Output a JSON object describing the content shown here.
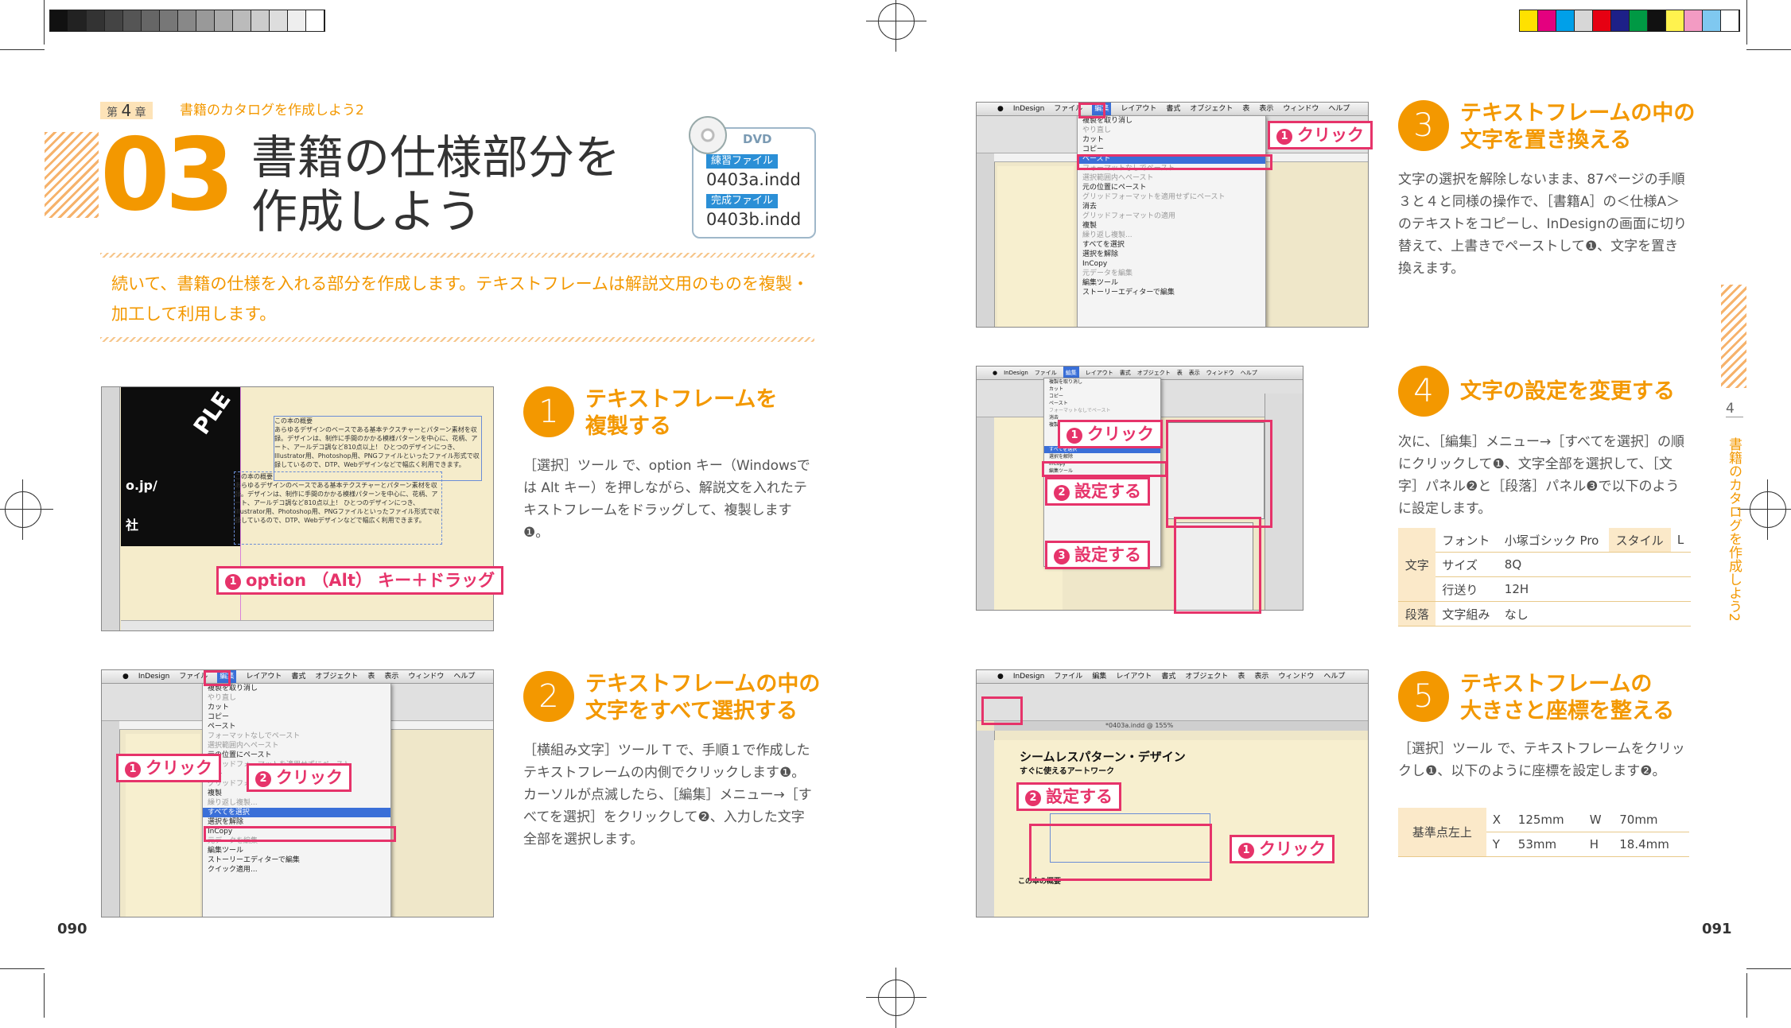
{
  "chapter": {
    "label_prefix": "第",
    "number": "4",
    "label_suffix": "章",
    "title": "書籍のカタログを作成しよう2"
  },
  "section": {
    "number": "03",
    "title_line1": "書籍の仕様部分を",
    "title_line2": "作成しよう"
  },
  "dvd": {
    "label": "DVD",
    "practice_label": "練習ファイル",
    "practice_file": "0403a.indd",
    "done_label": "完成ファイル",
    "done_file": "0403b.indd"
  },
  "intro": "続いて、書籍の仕様を入れる部分を作成します。テキストフレームは解説文用のものを複製・加工して利用します。",
  "steps": [
    {
      "number": "1",
      "title": "テキストフレームを\n複製する",
      "body": "［選択］ツール で、option キー（Windowsでは Alt キー）を押しながら、解説文を入れたテキストフレームをドラッグして、複製します❶。"
    },
    {
      "number": "2",
      "title": "テキストフレームの中の\n文字をすべて選択する",
      "body": "［横組み文字］ツール T で、手順１で作成したテキストフレームの内側でクリックします❶。カーソルが点滅したら、［編集］メニュー→［すべてを選択］をクリックして❷、入力した文字全部を選択します。"
    },
    {
      "number": "3",
      "title": "テキストフレームの中の\n文字を置き換える",
      "body": "文字の選択を解除しないまま、87ページの手順３と４と同様の操作で、［書籍A］の＜仕様A＞のテキストをコピーし、InDesignの画面に切り替えて、上書きでペーストして❶、文字を置き換えます。"
    },
    {
      "number": "4",
      "title": "文字の設定を変更する",
      "body": "次に、［編集］メニュー→［すべてを選択］の順にクリックして❶、文字全部を選択して、［文字］パネル❷と［段落］パネル❸で以下のように設定します。"
    },
    {
      "number": "5",
      "title": "テキストフレームの\n大きさと座標を整える",
      "body": "［選択］ツール で、テキストフレームをクリックし❶、以下のように座標を設定します❷。"
    }
  ],
  "callouts": {
    "s1": "option （Alt） キー＋ドラッグ",
    "s2a": "クリック",
    "s2b": "クリック",
    "s3": "クリック",
    "s4a": "クリック",
    "s4b": "設定する",
    "s4c": "設定する",
    "s5a": "設定する",
    "s5b": "クリック"
  },
  "table4": {
    "rows": [
      {
        "group": "文字",
        "label": "フォント",
        "value": "小塚ゴシック Pro",
        "label2": "スタイル",
        "value2": "L"
      },
      {
        "group": "",
        "label": "サイズ",
        "value": "8Q"
      },
      {
        "group": "",
        "label": "行送り",
        "value": "12H"
      },
      {
        "group": "段落",
        "label": "文字組み",
        "value": "なし"
      }
    ]
  },
  "table5": {
    "head": "基準点左上",
    "rows": [
      {
        "a": "X",
        "av": "125mm",
        "b": "W",
        "bv": "70mm"
      },
      {
        "a": "Y",
        "av": "53mm",
        "b": "H",
        "bv": "18.4mm"
      }
    ]
  },
  "menubar": [
    "InDesign",
    "ファイル",
    "編集",
    "レイアウト",
    "書式",
    "オブジェクト",
    "表",
    "表示",
    "ウィンドウ",
    "ヘルプ"
  ],
  "editmenu": [
    "複製を取り消し",
    "やり直し",
    "カット",
    "コピー",
    "ペースト",
    "フォーマットなしでペースト",
    "選択範囲内へペースト",
    "元の位置にペースト",
    "グリッドフォーマットを適用せずにペースト",
    "消去",
    "グリッドフォーマットの適用",
    "複製",
    "繰り返し複製...",
    "すべてを選択",
    "選択を解除",
    "InCopy",
    "元データを編集",
    "編集ツール",
    "ストーリーエディターで編集",
    "クイック適用..."
  ],
  "screen5": {
    "tab": "*0403a.indd @ 155%",
    "heading": "シームレスパターン・デザイン",
    "subheading": "すぐに使えるアートワーク",
    "about": "この本の概要"
  },
  "sidebar": {
    "number": "4",
    "text": "書籍のカタログを作成しよう2"
  },
  "page_numbers": {
    "left": "090",
    "right": "091"
  }
}
